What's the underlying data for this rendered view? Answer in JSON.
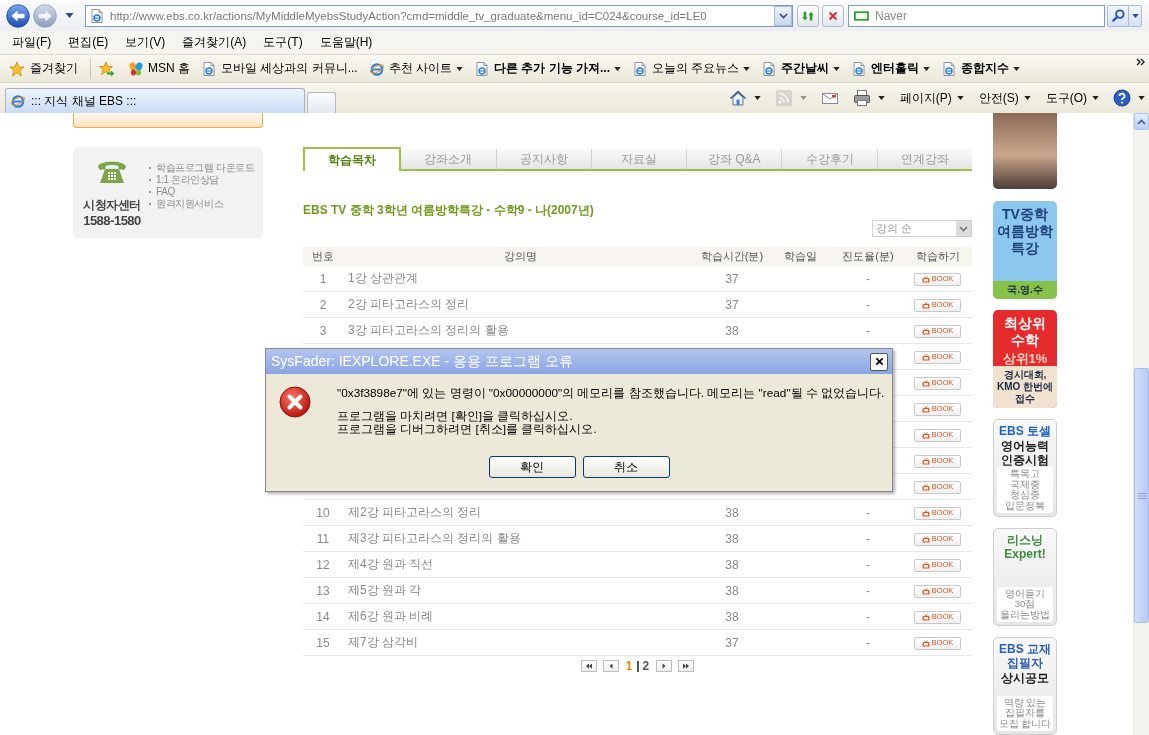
{
  "browser": {
    "navigation": [
      {
        "kind": "back",
        "disabled": false
      },
      {
        "kind": "forward",
        "disabled": true
      }
    ],
    "address": "http://www.ebs.co.kr/actions/MyMiddleMyebsStudyAction?cmd=middle_tv_graduate&menu_id=C024&course_id=LE0",
    "search": {
      "placeholder": "Naver"
    },
    "menu": [
      "파일(F)",
      "편집(E)",
      "보기(V)",
      "즐겨찾기(A)",
      "도구(T)",
      "도움말(H)"
    ],
    "favorites": {
      "label": "즐겨찾기",
      "links": [
        {
          "kind": "msn",
          "label": "MSN 홈",
          "bold": false,
          "dropdown": false
        },
        {
          "kind": "page",
          "label": "모바일 세상과의 커뮤니...",
          "bold": false,
          "dropdown": false
        },
        {
          "kind": "ie",
          "label": "추천 사이트",
          "bold": false,
          "dropdown": true
        },
        {
          "kind": "page",
          "label": "다른 추가 기능 가져...",
          "bold": true,
          "dropdown": true
        },
        {
          "kind": "page",
          "label": "오늘의 주요뉴스",
          "bold": false,
          "dropdown": true
        },
        {
          "kind": "page",
          "label": "주간날씨",
          "bold": true,
          "dropdown": true
        },
        {
          "kind": "page",
          "label": "엔터홀릭",
          "bold": true,
          "dropdown": true
        },
        {
          "kind": "page",
          "label": "종합지수",
          "bold": true,
          "dropdown": true
        }
      ]
    },
    "tabs": [
      {
        "label": "::: 지식 채널 EBS :::",
        "selected": true
      }
    ],
    "commands": [
      {
        "kind": "home",
        "dropdown": true,
        "disabled": false
      },
      {
        "kind": "feed",
        "dropdown": true,
        "disabled": true
      },
      {
        "kind": "mail",
        "dropdown": false,
        "disabled": false
      },
      {
        "kind": "print",
        "dropdown": true,
        "disabled": false
      },
      {
        "kind": "menu",
        "label": "페이지(P)",
        "dropdown": true,
        "disabled": false
      },
      {
        "kind": "menu",
        "label": "안전(S)",
        "dropdown": true,
        "disabled": false
      },
      {
        "kind": "menu",
        "label": "도구(O)",
        "dropdown": true,
        "disabled": false
      },
      {
        "kind": "help",
        "dropdown": true,
        "disabled": false
      }
    ]
  },
  "page": {
    "support": {
      "title": "시청자센터",
      "phone": "1588-1580",
      "links": [
        "학습프로그램 다운로드",
        "1:1 온라인상담",
        "FAQ",
        "원격지원서비스"
      ]
    },
    "course_tabs": [
      {
        "label": "학습목차",
        "selected": true
      },
      {
        "label": "강좌소개",
        "selected": false
      },
      {
        "label": "공지사항",
        "selected": false
      },
      {
        "label": "자료실",
        "selected": false
      },
      {
        "label": "강좌 Q&A",
        "selected": false
      },
      {
        "label": "수강후기",
        "selected": false
      },
      {
        "label": "연계강좌",
        "selected": false
      }
    ],
    "course_title": "EBS TV 중학 3학년 여름방학특강 - 수학9 - 나(2007년)",
    "sort": {
      "value": "강의 순"
    },
    "table": {
      "columns": [
        "번호",
        "강의명",
        "학습시간(분)",
        "학습일",
        "진도율(분)",
        "학습하기"
      ],
      "rows": [
        {
          "no": "1",
          "title": "1강 상관관계",
          "time": "37",
          "progress": "-",
          "button": "BOOK"
        },
        {
          "no": "2",
          "title": "2강 피타고라스의 정리",
          "time": "37",
          "progress": "-",
          "button": "BOOK"
        },
        {
          "no": "3",
          "title": "3강 피타고라스의 정리의 활용",
          "time": "38",
          "progress": "-",
          "button": "BOOK"
        },
        {
          "button": "BOOK"
        },
        {
          "button": "BOOK"
        },
        {
          "button": "BOOK"
        },
        {
          "button": "BOOK"
        },
        {
          "button": "BOOK"
        },
        {
          "button": "BOOK"
        },
        {
          "no": "10",
          "title": "제2강 피타고라스의 정리",
          "time": "38",
          "progress": "-",
          "button": "BOOK"
        },
        {
          "no": "11",
          "title": "제3강 피타고라스의 정리의 활용",
          "time": "38",
          "progress": "-",
          "button": "BOOK"
        },
        {
          "no": "12",
          "title": "제4강 원과 직선",
          "time": "38",
          "progress": "-",
          "button": "BOOK"
        },
        {
          "no": "13",
          "title": "제5강 원과 각",
          "time": "38",
          "progress": "-",
          "button": "BOOK"
        },
        {
          "no": "14",
          "title": "제6강 원과 비례",
          "time": "38",
          "progress": "-",
          "button": "BOOK"
        },
        {
          "no": "15",
          "title": "제7강 삼각비",
          "time": "37",
          "progress": "-",
          "button": "BOOK"
        }
      ]
    },
    "pagination": {
      "pages": [
        {
          "label": "1",
          "selected": true
        },
        {
          "label": "2",
          "selected": false
        }
      ]
    },
    "banners": [
      {
        "kind": "photo"
      },
      {
        "kind": "poster",
        "color": "#8cc8ee",
        "light_text": false,
        "title": "TV중학 여름방학 특강",
        "footer": {
          "text": "국.영.수",
          "color": "#86c24a"
        }
      },
      {
        "kind": "poster",
        "color": "#e52b2b",
        "light_text": true,
        "title": "최상위 수학",
        "highlight": "상위1%",
        "footer": {
          "text": "경시대회, KMO 한번에 접수",
          "color": "#f1e2cf"
        }
      },
      {
        "kind": "card",
        "color": "#1a63c9",
        "heading": "EBS 토셀",
        "title": "영어능력 인증시험",
        "note": "특목고 국제중 청심중 입문정복"
      },
      {
        "kind": "card",
        "color": "#3f8a3a",
        "heading": "리스닝 Expert!",
        "note": "영어듣기 30점 올리는방법"
      },
      {
        "kind": "card",
        "color": "#2b5fb4",
        "heading": "EBS 교재 집필자",
        "title": "상시공모",
        "note": "역량 있는 집필자를 모집 합니다"
      }
    ],
    "dialog": {
      "title": "SysFader: IEXPLORE.EXE - 응용 프로그램 오류",
      "message": "\"0x3f3898e7\"에 있는 명령이 \"0x00000000\"의 메모리를 참조했습니다. 메모리는 \"read\"될 수 없었습니다.",
      "instructions": [
        "프로그램을 마치려면 [확인]을 클릭하십시오.",
        "프로그램을 디버그하려면 [취소]를 클릭하십시오."
      ],
      "buttons": [
        "확인",
        "취소"
      ]
    }
  }
}
